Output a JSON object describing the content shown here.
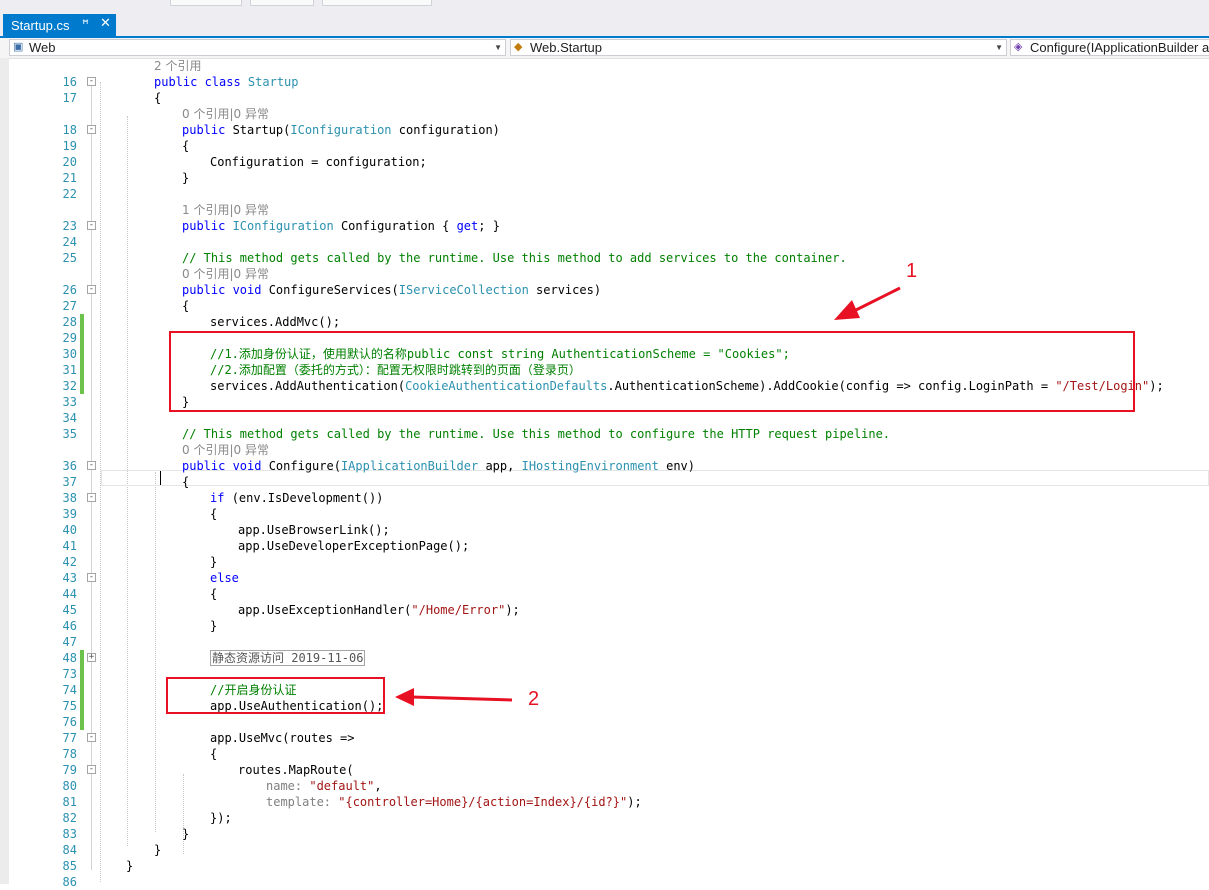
{
  "tab": {
    "title": "Startup.cs",
    "pin_glyph": "ꟸ",
    "close_glyph": "✕"
  },
  "nav": {
    "project": "Web",
    "class": "Web.Startup",
    "member": "Configure(IApplicationBuilder a"
  },
  "lines": [
    {
      "n": "",
      "indent": 4,
      "lens": "2 个引用"
    },
    {
      "n": "16",
      "fold": "-",
      "indent": 4,
      "t": [
        [
          "kw",
          "public class "
        ],
        [
          "type",
          "Startup"
        ]
      ]
    },
    {
      "n": "17",
      "indent": 4,
      "t": [
        [
          "",
          "{"
        ]
      ]
    },
    {
      "n": "",
      "indent": 8,
      "lens": "0 个引用|0 异常"
    },
    {
      "n": "18",
      "fold": "-",
      "indent": 8,
      "t": [
        [
          "kw",
          "public "
        ],
        [
          "",
          "Startup("
        ],
        [
          "type",
          "IConfiguration"
        ],
        [
          "",
          " configuration)"
        ]
      ]
    },
    {
      "n": "19",
      "indent": 8,
      "t": [
        [
          "",
          "{"
        ]
      ]
    },
    {
      "n": "20",
      "indent": 12,
      "t": [
        [
          "",
          "Configuration = configuration;"
        ]
      ]
    },
    {
      "n": "21",
      "indent": 8,
      "t": [
        [
          "",
          "}"
        ]
      ]
    },
    {
      "n": "22",
      "indent": 8,
      "t": []
    },
    {
      "n": "",
      "indent": 8,
      "lens": "1 个引用|0 异常"
    },
    {
      "n": "23",
      "fold": "-",
      "indent": 8,
      "t": [
        [
          "kw",
          "public "
        ],
        [
          "type",
          "IConfiguration"
        ],
        [
          "",
          " Configuration { "
        ],
        [
          "kw",
          "get"
        ],
        [
          "",
          "; }"
        ]
      ]
    },
    {
      "n": "24",
      "indent": 8,
      "t": []
    },
    {
      "n": "25",
      "indent": 8,
      "t": [
        [
          "cm",
          "// This method gets called by the runtime. Use this method to add services to the container."
        ]
      ]
    },
    {
      "n": "",
      "indent": 8,
      "lens": "0 个引用|0 异常"
    },
    {
      "n": "26",
      "fold": "-",
      "indent": 8,
      "t": [
        [
          "kw",
          "public void "
        ],
        [
          "",
          "ConfigureServices("
        ],
        [
          "type",
          "IServiceCollection"
        ],
        [
          "",
          " services)"
        ]
      ]
    },
    {
      "n": "27",
      "indent": 8,
      "t": [
        [
          "",
          "{"
        ]
      ]
    },
    {
      "n": "28",
      "chg": true,
      "indent": 12,
      "t": [
        [
          "",
          "services.AddMvc();"
        ]
      ]
    },
    {
      "n": "29",
      "chg": true,
      "indent": 12,
      "t": []
    },
    {
      "n": "30",
      "chg": true,
      "indent": 12,
      "t": [
        [
          "cm",
          "//1.添加身份认证，使用默认的名称public const string AuthenticationScheme = \"Cookies\";"
        ]
      ]
    },
    {
      "n": "31",
      "chg": true,
      "indent": 12,
      "t": [
        [
          "cm",
          "//2.添加配置（委托的方式）：配置无权限时跳转到的页面（登录页）"
        ]
      ]
    },
    {
      "n": "32",
      "chg": true,
      "indent": 12,
      "t": [
        [
          "",
          "services.AddAuthentication("
        ],
        [
          "type",
          "CookieAuthenticationDefaults"
        ],
        [
          "",
          ".AuthenticationScheme).AddCookie(config => config.LoginPath = "
        ],
        [
          "str",
          "\"/Test/Login\""
        ],
        [
          "",
          ");"
        ]
      ]
    },
    {
      "n": "33",
      "indent": 8,
      "t": [
        [
          "",
          "}"
        ]
      ]
    },
    {
      "n": "34",
      "indent": 8,
      "t": []
    },
    {
      "n": "35",
      "indent": 8,
      "t": [
        [
          "cm",
          "// This method gets called by the runtime. Use this method to configure the HTTP request pipeline."
        ]
      ]
    },
    {
      "n": "",
      "indent": 8,
      "lens": "0 个引用|0 异常"
    },
    {
      "n": "36",
      "fold": "-",
      "indent": 8,
      "t": [
        [
          "kw",
          "public void "
        ],
        [
          "",
          "Configure("
        ],
        [
          "type",
          "IApplicationBuilder"
        ],
        [
          "",
          " app, "
        ],
        [
          "type",
          "IHostingEnvironment"
        ],
        [
          "",
          " env)"
        ]
      ]
    },
    {
      "n": "37",
      "indent": 8,
      "t": [
        [
          "",
          "{"
        ]
      ]
    },
    {
      "n": "38",
      "fold": "-",
      "indent": 12,
      "t": [
        [
          "kw",
          "if "
        ],
        [
          "",
          "(env.IsDevelopment())"
        ]
      ]
    },
    {
      "n": "39",
      "indent": 12,
      "t": [
        [
          "",
          "{"
        ]
      ]
    },
    {
      "n": "40",
      "indent": 16,
      "t": [
        [
          "",
          "app.UseBrowserLink();"
        ]
      ]
    },
    {
      "n": "41",
      "indent": 16,
      "t": [
        [
          "",
          "app.UseDeveloperExceptionPage();"
        ]
      ]
    },
    {
      "n": "42",
      "indent": 12,
      "t": [
        [
          "",
          "}"
        ]
      ]
    },
    {
      "n": "43",
      "fold": "-",
      "indent": 12,
      "t": [
        [
          "kw",
          "else"
        ]
      ]
    },
    {
      "n": "44",
      "indent": 12,
      "t": [
        [
          "",
          "{"
        ]
      ]
    },
    {
      "n": "45",
      "indent": 16,
      "t": [
        [
          "",
          "app.UseExceptionHandler("
        ],
        [
          "str",
          "\"/Home/Error\""
        ],
        [
          "",
          ");"
        ]
      ]
    },
    {
      "n": "46",
      "indent": 12,
      "t": [
        [
          "",
          "}"
        ]
      ]
    },
    {
      "n": "47",
      "indent": 12,
      "t": []
    },
    {
      "n": "48",
      "fold": "+",
      "chg": true,
      "indent": 12,
      "t": [
        [
          "collapsed",
          "静态资源访问 2019-11-06"
        ]
      ]
    },
    {
      "n": "73",
      "chg": true,
      "indent": 12,
      "t": []
    },
    {
      "n": "74",
      "chg": true,
      "indent": 12,
      "t": [
        [
          "cm",
          "//开启身份认证"
        ]
      ]
    },
    {
      "n": "75",
      "chg": true,
      "indent": 12,
      "t": [
        [
          "",
          "app.UseAuthentication();"
        ]
      ]
    },
    {
      "n": "76",
      "chg": true,
      "indent": 12,
      "t": []
    },
    {
      "n": "77",
      "fold": "-",
      "indent": 12,
      "t": [
        [
          "",
          "app.UseMvc(routes =>"
        ]
      ]
    },
    {
      "n": "78",
      "indent": 12,
      "t": [
        [
          "",
          "{"
        ]
      ]
    },
    {
      "n": "79",
      "fold": "-",
      "indent": 16,
      "t": [
        [
          "",
          "routes.MapRoute("
        ]
      ]
    },
    {
      "n": "80",
      "indent": 20,
      "t": [
        [
          "param",
          "name: "
        ],
        [
          "str",
          "\"default\""
        ],
        [
          "",
          ","
        ]
      ]
    },
    {
      "n": "81",
      "indent": 20,
      "t": [
        [
          "param",
          "template: "
        ],
        [
          "str",
          "\"{controller=Home}/{action=Index}/{id?}\""
        ],
        [
          "",
          ");"
        ]
      ]
    },
    {
      "n": "82",
      "indent": 12,
      "t": [
        [
          "",
          "});"
        ]
      ]
    },
    {
      "n": "83",
      "indent": 8,
      "t": [
        [
          "",
          "}"
        ]
      ]
    },
    {
      "n": "84",
      "indent": 4,
      "t": [
        [
          "",
          "}"
        ]
      ]
    },
    {
      "n": "85",
      "indent": 0,
      "t": [
        [
          "",
          "}"
        ]
      ]
    },
    {
      "n": "86",
      "indent": 0,
      "t": []
    }
  ],
  "annotations": [
    {
      "label": "1"
    },
    {
      "label": "2"
    }
  ],
  "colors": {
    "accent": "#007acc",
    "keyword": "#0000ff",
    "type": "#2b91af",
    "comment": "#008000",
    "string": "#a31515",
    "annotation": "#e81123",
    "changed": "#6cc24a"
  }
}
